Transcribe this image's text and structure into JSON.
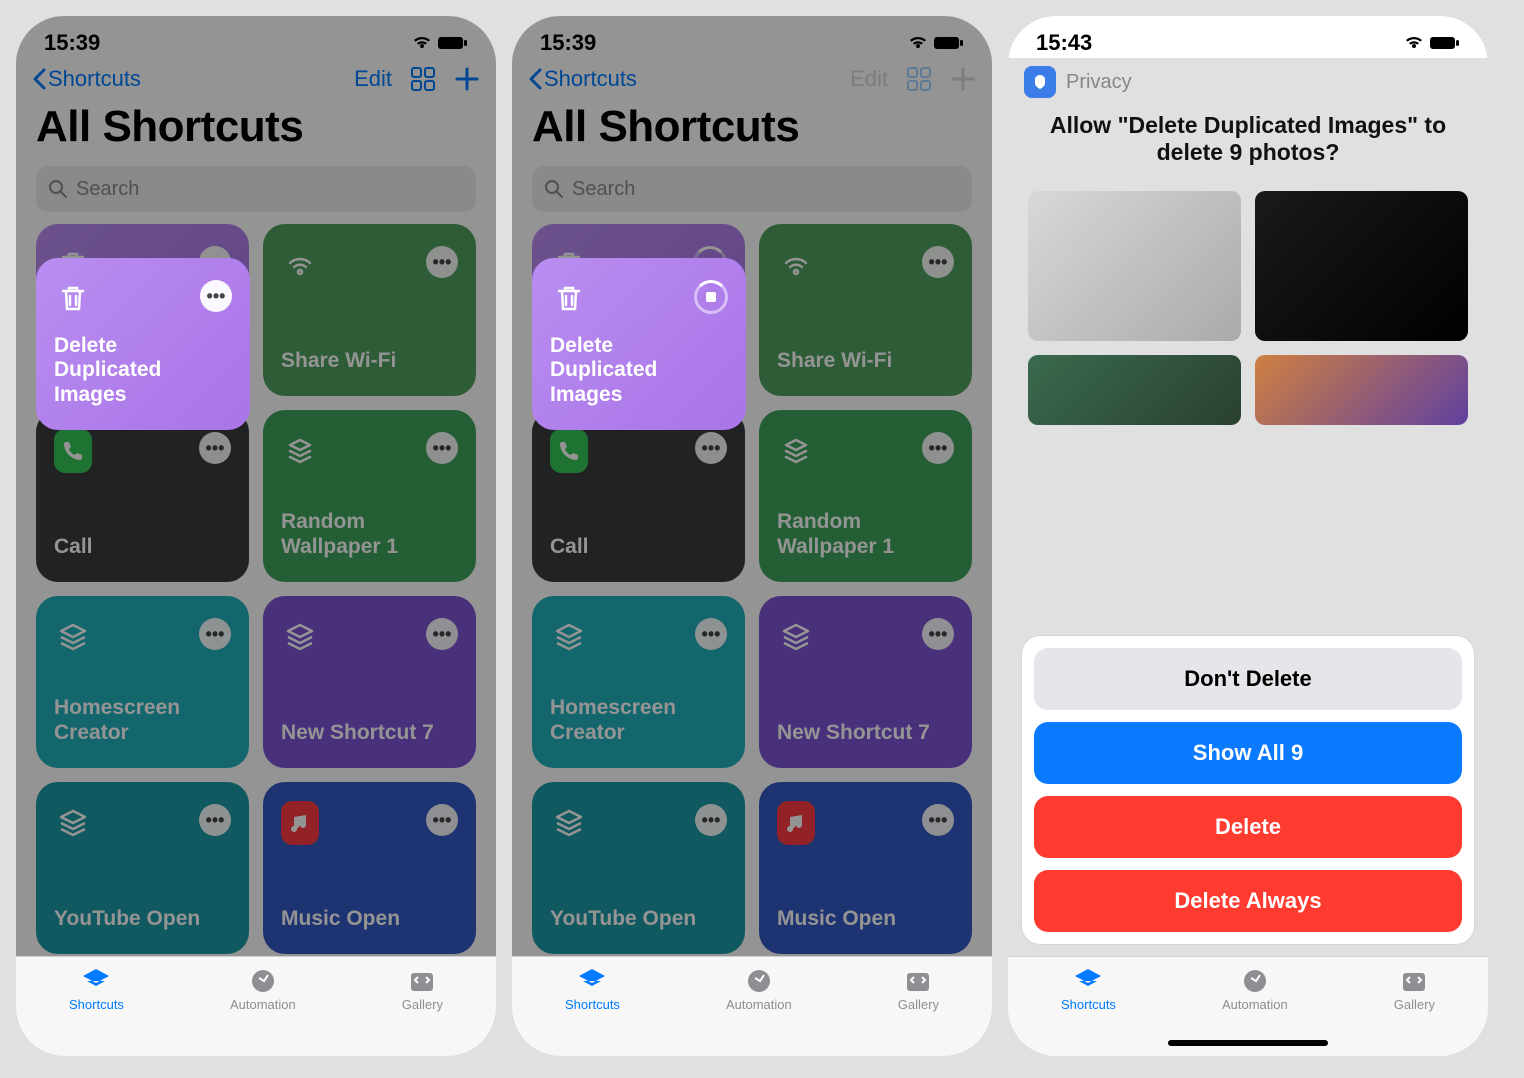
{
  "status_time_a": "15:39",
  "status_time_b": "15:39",
  "status_time_c": "15:43",
  "nav_back": "Shortcuts",
  "nav_edit": "Edit",
  "title": "All Shortcuts",
  "search_placeholder": "Search",
  "tiles": [
    {
      "label": "Delete\nDuplicated\nImages",
      "color": "purple",
      "icon": "trash"
    },
    {
      "label": "Share Wi-Fi",
      "color": "green-d",
      "icon": "wifi"
    },
    {
      "label": "Call",
      "color": "gray",
      "icon": "phone"
    },
    {
      "label": "Random\nWallpaper 1",
      "color": "green",
      "icon": "stack"
    },
    {
      "label": "Homescreen\nCreator",
      "color": "teal",
      "icon": "layers"
    },
    {
      "label": "New Shortcut 7",
      "color": "violet",
      "icon": "layers"
    },
    {
      "label": "YouTube Open",
      "color": "teal2",
      "icon": "layers"
    },
    {
      "label": "Music Open",
      "color": "blue",
      "icon": "music"
    }
  ],
  "tabs": {
    "shortcuts": "Shortcuts",
    "automation": "Automation",
    "gallery": "Gallery"
  },
  "privacy_label": "Privacy",
  "sheet_prompt": "Allow \"Delete Duplicated Images\" to delete 9 photos?",
  "actions": {
    "dont_delete": "Don't Delete",
    "show_all": "Show All 9",
    "delete": "Delete",
    "delete_always": "Delete Always"
  }
}
